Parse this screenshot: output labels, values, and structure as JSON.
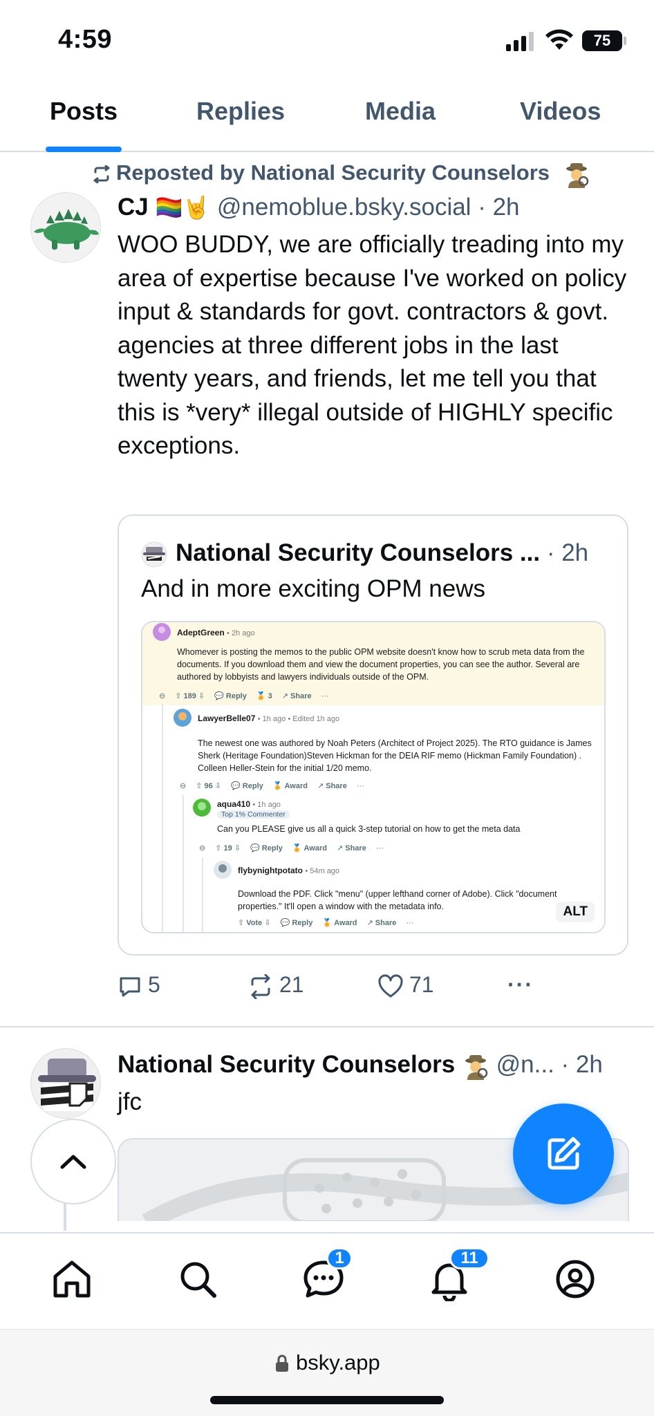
{
  "status_bar": {
    "time": "4:59",
    "battery": "75"
  },
  "tabs": [
    {
      "label": "Posts",
      "active": true
    },
    {
      "label": "Replies",
      "active": false
    },
    {
      "label": "Media",
      "active": false
    },
    {
      "label": "Videos",
      "active": false
    }
  ],
  "post1": {
    "repost_text": "Reposted by National Security Counselors",
    "author_name": "CJ",
    "author_emojis": "🏳️‍🌈🤘",
    "handle": "@nemoblue.bsky.social",
    "time": "· 2h",
    "body": "WOO BUDDY, we are officially treading into my area of expertise because I've worked on policy input & standards for govt. contractors & govt. agencies at three different jobs in the last twenty years, and friends, let me tell you that this is *very* illegal outside of HIGHLY specific exceptions.",
    "quote": {
      "author": "National Security Counselors ...",
      "time": "· 2h",
      "text": "And in more exciting OPM news",
      "alt_label": "ALT",
      "comments": [
        {
          "user": "AdeptGreen",
          "meta": "• 2h ago",
          "text": "Whomever is posting the memos to the public OPM website doesn't know how to scrub meta data from the documents. If you download them and view the document properties, you can see the author. Several are authored by lobbyists and lawyers individuals outside of the OPM.",
          "actions": [
            "189",
            "Reply",
            "3",
            "Share",
            "···"
          ]
        },
        {
          "user": "LawyerBelle07",
          "meta": "• 1h ago • Edited 1h ago",
          "text": "The newest one was authored by Noah Peters (Architect of Project 2025). The RTO guidance is James Sherk (Heritage Foundation)Steven Hickman for the DEIA RIF memo (Hickman Family Foundation) . Colleen Heller-Stein for the initial 1/20 memo.",
          "actions": [
            "96",
            "Reply",
            "Award",
            "Share",
            "···"
          ]
        },
        {
          "user": "aqua410",
          "meta": "• 1h ago",
          "flair": "Top 1% Commenter",
          "text": "Can you PLEASE give us all a quick 3-step tutorial on how to get the meta data",
          "actions": [
            "19",
            "Reply",
            "Award",
            "Share",
            "···"
          ]
        },
        {
          "user": "flybynightpotato",
          "meta": "• 54m ago",
          "text": "Download the PDF. Click \"menu\" (upper lefthand corner of Adobe). Click \"document properties.\" It'll open a window with the metadata info.",
          "actions": [
            "Vote",
            "Reply",
            "Award",
            "Share",
            "···"
          ]
        }
      ]
    },
    "stats": {
      "replies": "5",
      "reposts": "21",
      "likes": "71",
      "more": "···"
    }
  },
  "post2": {
    "author_name": "National Security Counselors",
    "handle": "@n...",
    "time": "· 2h",
    "text": "jfc"
  },
  "bottom_nav": {
    "items": [
      "home-icon",
      "search-icon",
      "chat-icon",
      "notifications-icon",
      "profile-icon"
    ],
    "chat_badge": "1",
    "notifications_badge": "11"
  },
  "browser": {
    "url": "bsky.app"
  },
  "colors": {
    "accent": "#1083fe",
    "muted": "#42576c",
    "border": "#d6dde4"
  }
}
